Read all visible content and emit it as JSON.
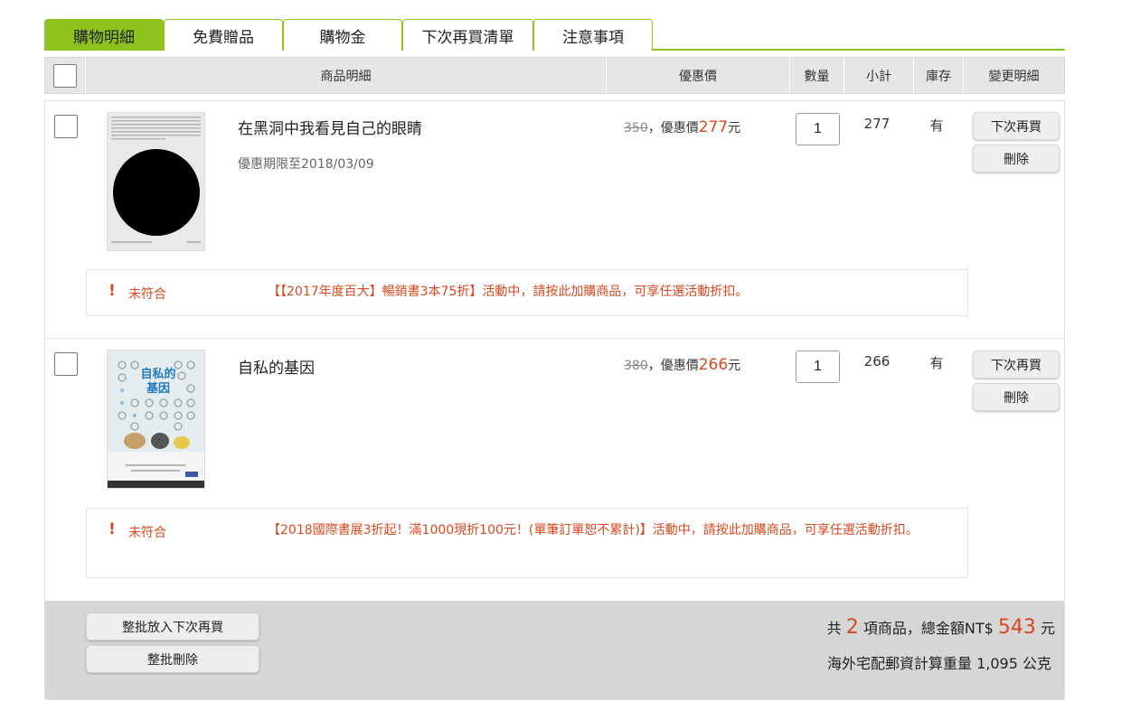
{
  "tabs": [
    {
      "label": "購物明細",
      "active": true
    },
    {
      "label": "免費贈品",
      "active": false
    },
    {
      "label": "購物金",
      "active": false
    },
    {
      "label": "下次再買清單",
      "active": false
    },
    {
      "label": "注意事項",
      "active": false
    }
  ],
  "columns": {
    "details": "商品明細",
    "price": "優惠價",
    "quantity": "數量",
    "subtotal": "小計",
    "stock": "庫存",
    "actions": "變更明細"
  },
  "items": [
    {
      "title": "在黑洞中我看見自己的眼睛",
      "promo_date": "優惠期限至2018/03/09",
      "original_price": "350",
      "price_prefix": "，優惠價",
      "sale_price": "277",
      "currency_suffix": "元",
      "quantity": "1",
      "subtotal": "277",
      "stock": "有",
      "btn_later": "下次再買",
      "btn_delete": "刪除",
      "notice_mark": "!",
      "notice_status": "未符合",
      "notice_message": "【【2017年度百大】暢銷書3本75折】活動中，請按此加購商品，可享任選活動折扣。"
    },
    {
      "title": "自私的基因",
      "promo_date": "",
      "original_price": "380",
      "price_prefix": "，優惠價",
      "sale_price": "266",
      "currency_suffix": "元",
      "quantity": "1",
      "subtotal": "266",
      "stock": "有",
      "btn_later": "下次再買",
      "btn_delete": "刪除",
      "notice_mark": "!",
      "notice_status": "未符合",
      "notice_message": "【2018國際書展3折起！滿1000現折100元！(單筆訂單恕不累計)】活動中，請按此加購商品，可享任選活動折扣。",
      "cover_text": "自私的基因"
    }
  ],
  "footer": {
    "batch_later": "整批放入下次再買",
    "batch_delete": "整批刪除",
    "summary_prefix": "共",
    "item_count": "2",
    "summary_mid": "項商品，總金額NT$",
    "total": "543",
    "summary_suffix": "元",
    "weight_text": "海外宅配郵資計算重量 1,095 公克"
  },
  "colors": {
    "accent_green": "#8dc21f",
    "price_red": "#d9481e"
  }
}
